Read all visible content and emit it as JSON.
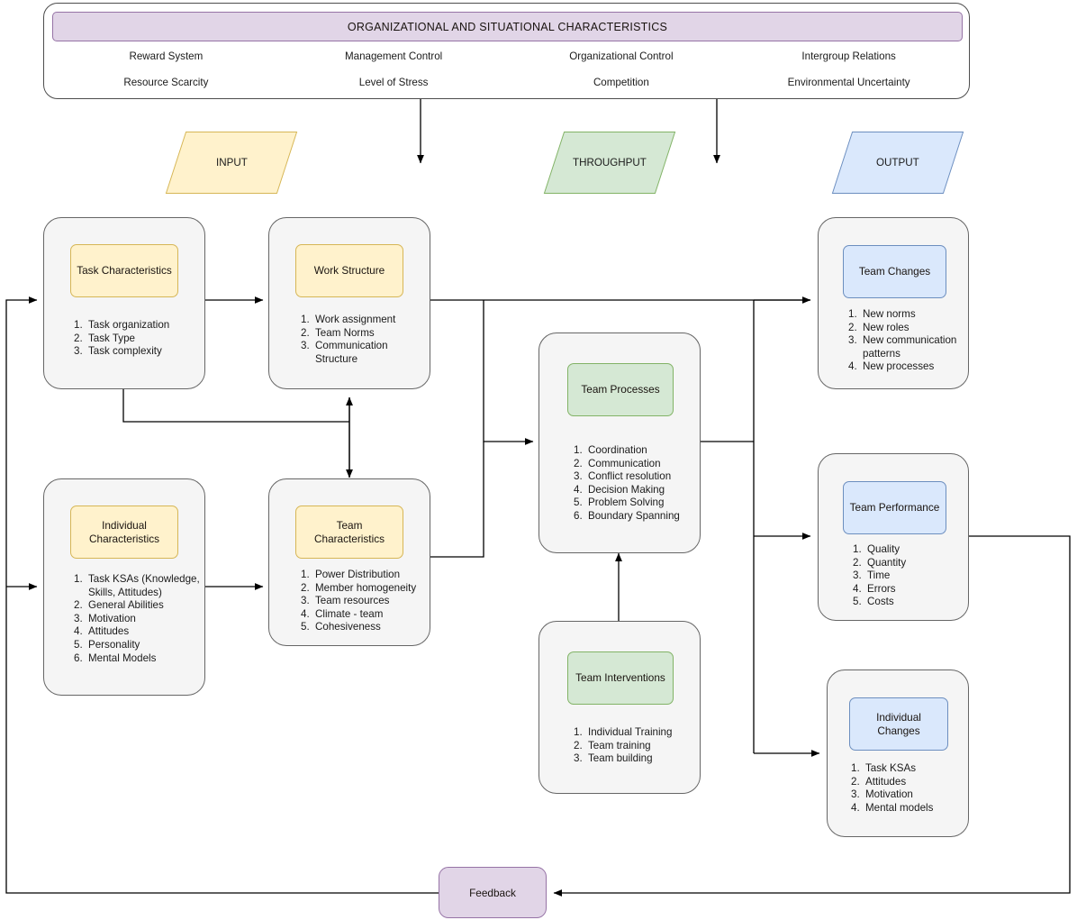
{
  "header": {
    "title": "ORGANIZATIONAL AND SITUATIONAL CHARACTERISTICS",
    "factors": [
      "Reward System",
      "Management Control",
      "Organizational Control",
      "Intergroup Relations",
      "Resource Scarcity",
      "Level of Stress",
      "Competition",
      "Environmental Uncertainty"
    ]
  },
  "phases": {
    "input": "INPUT",
    "throughput": "THROUGHPUT",
    "output": "OUTPUT"
  },
  "nodes": {
    "task_characteristics": {
      "title": "Task Characteristics",
      "items": [
        "Task organization",
        "Task Type",
        "Task complexity"
      ]
    },
    "work_structure": {
      "title": "Work Structure",
      "items": [
        "Work assignment",
        "Team Norms",
        "Communication Structure"
      ]
    },
    "individual_characteristics": {
      "title": "Individual Characteristics",
      "items": [
        "Task KSAs (Knowledge, Skills, Attitudes)",
        "General Abilities",
        "Motivation",
        "Attitudes",
        "Personality",
        "Mental Models"
      ]
    },
    "team_characteristics": {
      "title": "Team Characteristics",
      "items": [
        "Power Distribution",
        "Member homogeneity",
        "Team resources",
        "Climate - team",
        "Cohesiveness"
      ]
    },
    "team_processes": {
      "title": "Team Processes",
      "items": [
        "Coordination",
        "Communication",
        "Conflict resolution",
        "Decision Making",
        "Problem Solving",
        "Boundary Spanning"
      ]
    },
    "team_interventions": {
      "title": "Team Interventions",
      "items": [
        "Individual Training",
        "Team training",
        "Team building"
      ]
    },
    "team_changes": {
      "title": "Team Changes",
      "items": [
        "New norms",
        "New roles",
        "New communication patterns",
        "New processes"
      ]
    },
    "team_performance": {
      "title": "Team Performance",
      "items": [
        "Quality",
        "Quantity",
        "Time",
        "Errors",
        "Costs"
      ]
    },
    "individual_changes": {
      "title": "Individual Changes",
      "items": [
        "Task KSAs",
        "Attitudes",
        "Motivation",
        "Mental models"
      ]
    },
    "feedback": {
      "title": "Feedback"
    }
  },
  "colors": {
    "input_fill": "#fff2cc",
    "input_stroke": "#d6b656",
    "throughput_fill": "#d5e8d4",
    "throughput_stroke": "#82b366",
    "output_fill": "#dae8fc",
    "output_stroke": "#6c8ebf",
    "accent_fill": "#e1d5e7",
    "accent_stroke": "#9673a6",
    "box_fill": "#f5f5f5",
    "box_stroke": "#666666",
    "edge_stroke": "#000000"
  }
}
